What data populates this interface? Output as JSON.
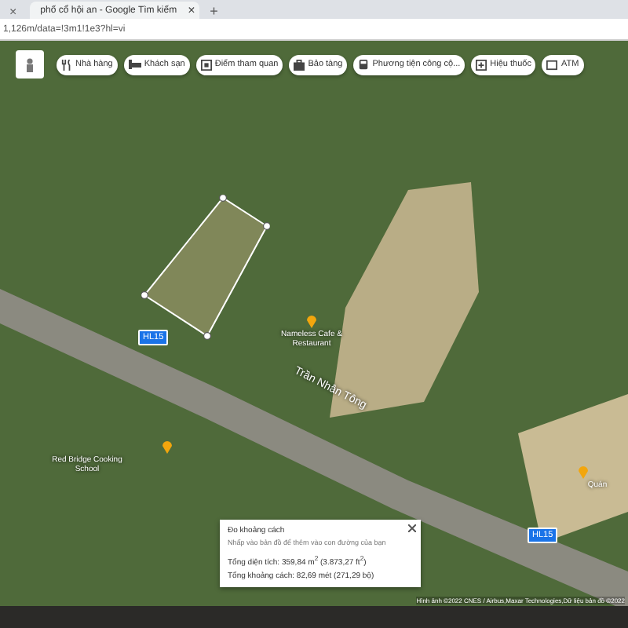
{
  "browser": {
    "tabs": [
      {
        "close": "×",
        "selected": false
      },
      {
        "title": "phố cổ hội an - Google Tìm kiếm",
        "close": "×",
        "selected": true
      }
    ],
    "new_tab": "+",
    "address": "1,126m/data=!3m1!1e3?hl=vi"
  },
  "chips": [
    {
      "label": "Nhà hàng",
      "kind": "restaurant"
    },
    {
      "label": "Khách sạn",
      "kind": "hotel"
    },
    {
      "label": "Điểm tham quan",
      "kind": "attraction"
    },
    {
      "label": "Bảo tàng",
      "kind": "museum"
    },
    {
      "label": "Phương tiện công cộ...",
      "kind": "transit"
    },
    {
      "label": "Hiệu thuốc",
      "kind": "pharmacy"
    },
    {
      "label": "ATM",
      "kind": "atm"
    }
  ],
  "map": {
    "road_name": "Trần Nhân Tông",
    "road_shields": [
      "HL15",
      "HL15"
    ],
    "places": [
      {
        "label": "Nameless Cafe & Restaurant",
        "kind": "food"
      },
      {
        "label": "Red Bridge Cooking School",
        "kind": "food"
      },
      {
        "label": "Quán",
        "kind": "food"
      }
    ]
  },
  "measure_popup": {
    "title": "Đo khoảng cách",
    "hint": "Nhấp vào bản đồ để thêm vào con đường của bạn",
    "area": "Tổng diện tích: 359,84 m$^{2}$ (3.873,27 ft$^{2}$)",
    "distance": "Tổng khoảng cách: 82,69 mét (271,29 bộ)"
  },
  "attribution": "Hình ảnh ©2022 CNES / Airbus,Maxar Technologies,Dữ liệu bản đồ ©2022"
}
